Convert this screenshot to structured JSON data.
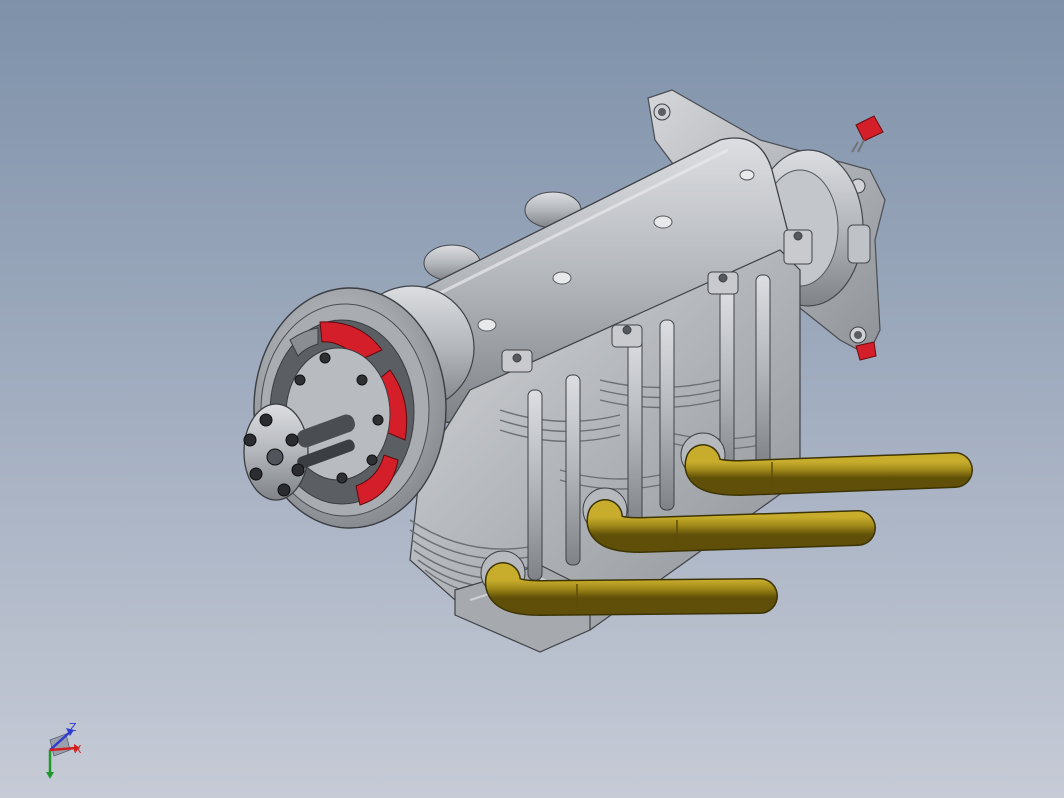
{
  "viewport": {
    "background_top": "#7e91a9",
    "background_bottom": "#c6cbd6"
  },
  "model": {
    "body_color": "#b9bcc1",
    "exhaust_color": "#a08b16",
    "accent_color": "#d41f2a"
  },
  "triad": {
    "z_label": "Z",
    "x_label": "X",
    "z_color": "#2f3cd0",
    "x_color": "#d02020",
    "y_color": "#1e9a2a"
  }
}
